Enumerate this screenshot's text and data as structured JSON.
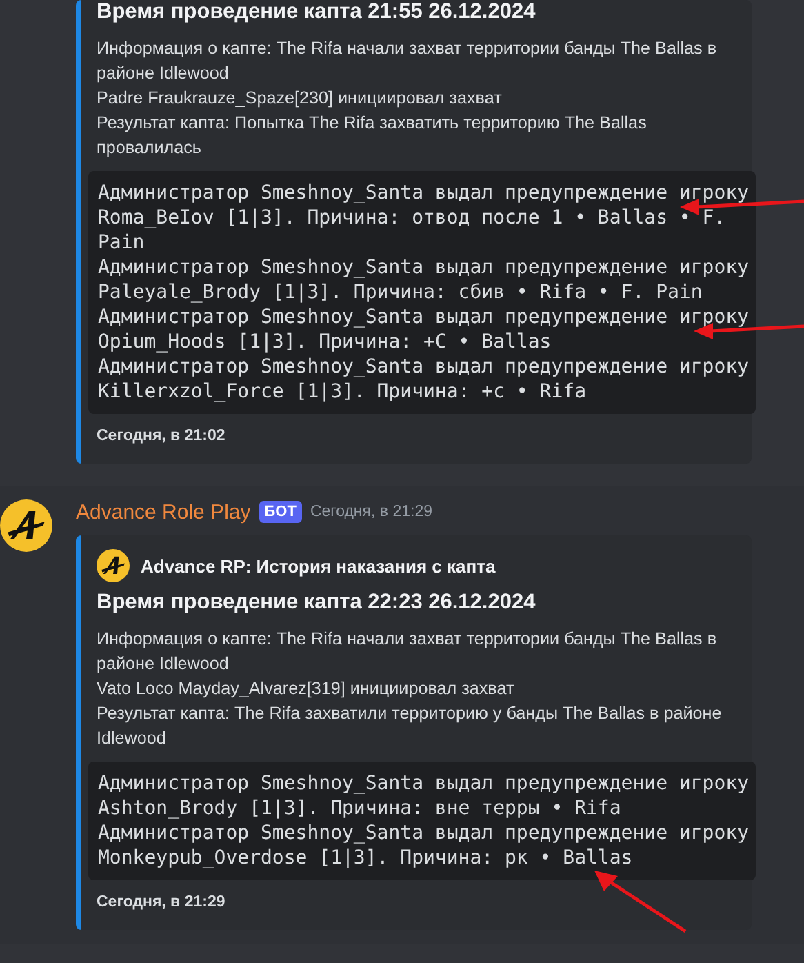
{
  "messages": [
    {
      "embed": {
        "title": "Время проведение капта 21:55 26.12.2024",
        "description": [
          "Информация о капте: The Rifa начали захват территории банды The Ballas в районе Idlewood",
          "Padre Fraukrauze_Spaze[230] инициировал захват",
          "Результат капта: Попытка The Rifa захватить территорию The Ballas провалилась"
        ],
        "warnings": [
          {
            "text": "Администратор Smeshnoy_Santa выдал предупреждение игроку Roma_BeIov [1|3]. Причина: отвод после 1 • Ballas • F. Pain",
            "annotated": true
          },
          {
            "text": "Администратор Smeshnoy_Santa выдал предупреждение игроку Paleyale_Brody [1|3]. Причина: сбив • Rifa • F. Pain",
            "annotated": false
          },
          {
            "text": "Администратор Smeshnoy_Santa выдал предупреждение игроку Opium_Hoods [1|3]. Причина: +С • Ballas",
            "annotated": true
          },
          {
            "text": "Администратор Smeshnoy_Santa выдал предупреждение игроку Killerxzol_Force [1|3]. Причина: +с • Rifa",
            "annotated": false
          }
        ],
        "footer": "Сегодня, в 21:02"
      }
    },
    {
      "author": {
        "name": "Advance Role Play",
        "badge": "БОТ",
        "time": "Сегодня, в 21:29"
      },
      "embed": {
        "author": "Advance RP: История наказания с капта",
        "title": "Время проведение капта 22:23 26.12.2024",
        "description": [
          "Информация о капте: The Rifa начали захват территории банды The Ballas в районе Idlewood",
          "Vato Loco Mayday_Alvarez[319] инициировал захват",
          "Результат капта: The Rifa захватили территорию у банды The Ballas в районе Idlewood"
        ],
        "warnings": [
          {
            "text": "Администратор Smeshnoy_Santa выдал предупреждение игроку Ashton_Brody [1|3]. Причина: вне терры • Rifa",
            "annotated": false
          },
          {
            "text": "Администратор Smeshnoy_Santa выдал предупреждение игроку Monkeypub_Overdose [1|3]. Причина: рк • Ballas",
            "annotated": true
          }
        ],
        "footer": "Сегодня, в 21:29"
      }
    }
  ]
}
